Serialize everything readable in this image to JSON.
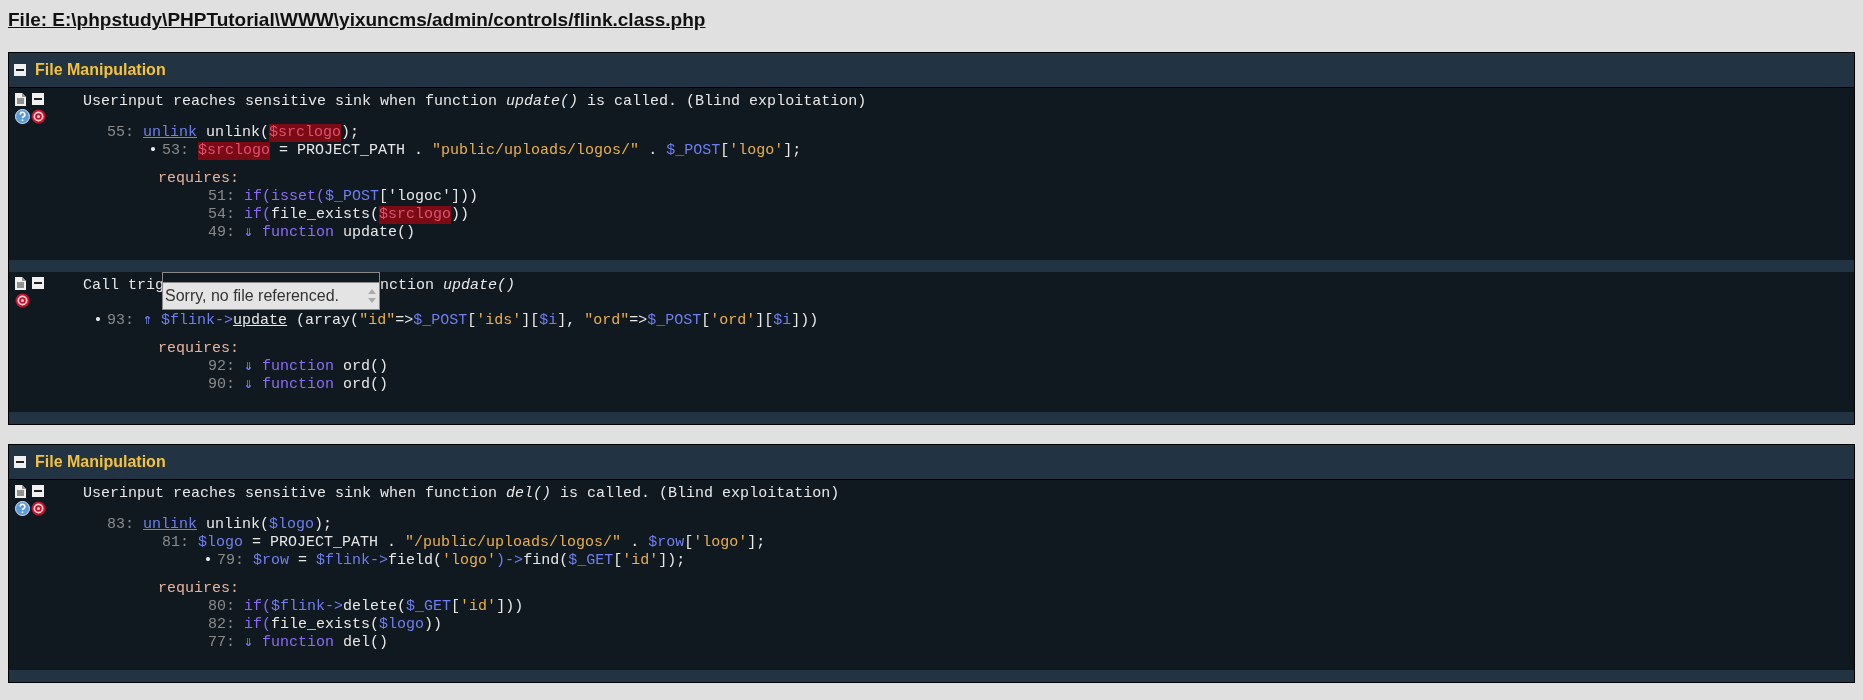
{
  "file_title": "File: E:\\phpstudy\\PHPTutorial\\WWW\\yixuncms/admin/controls/flink.class.php",
  "groups": [
    {
      "title": "File Manipulation",
      "findings": [
        {
          "help": true,
          "description": [
            "Userinput reaches sensitive sink when function *update()* is called. (Blind exploitation)"
          ],
          "trace": [
            {
              "line": "55:",
              "tokens": [
                {
                  "kind": "link",
                  "text": "unlink"
                },
                {
                  "kind": "plain",
                  "text": " unlink("
                },
                {
                  "kind": "taint",
                  "text": "$srclogo"
                },
                {
                  "kind": "plain",
                  "text": ");"
                }
              ],
              "children": [
                {
                  "line": "53:",
                  "marker": "•",
                  "tokens": [
                    {
                      "kind": "taint",
                      "text": "$srclogo"
                    },
                    {
                      "kind": "plain",
                      "text": " = PROJECT_PATH . "
                    },
                    {
                      "kind": "str",
                      "text": "\"public/uploads/logos/\""
                    },
                    {
                      "kind": "plain",
                      "text": " . "
                    },
                    {
                      "kind": "var",
                      "text": "$_POST"
                    },
                    {
                      "kind": "plain",
                      "text": "["
                    },
                    {
                      "kind": "str",
                      "text": "'logo'"
                    },
                    {
                      "kind": "plain",
                      "text": "];"
                    }
                  ]
                }
              ]
            }
          ],
          "requires": {
            "label": "requires:",
            "lines": [
              {
                "line": "51:",
                "tokens": [
                  {
                    "kind": "kw",
                    "text": "if(isset("
                  },
                  {
                    "kind": "var",
                    "text": "$_POST"
                  },
                  {
                    "kind": "plain",
                    "text": "['logoc']))"
                  }
                ]
              },
              {
                "line": "54:",
                "tokens": [
                  {
                    "kind": "kw",
                    "text": "if("
                  },
                  {
                    "kind": "plain",
                    "text": "file_exists("
                  },
                  {
                    "kind": "taint",
                    "text": "$srclogo"
                  },
                  {
                    "kind": "plain",
                    "text": "))"
                  }
                ]
              },
              {
                "line": "49:",
                "tokens": [
                  {
                    "kind": "arrow",
                    "text": "⇓ "
                  },
                  {
                    "kind": "kw",
                    "text": "function"
                  },
                  {
                    "kind": "plain",
                    "text": " update()"
                  }
                ]
              }
            ]
          }
        },
        {
          "help": false,
          "description": [
            "Call trig",
            "nction *update()*"
          ],
          "tooltip": "Sorry, no file referenced.",
          "trace": [
            {
              "line": "93:",
              "marker": "•",
              "tokens": [
                {
                  "kind": "arrow",
                  "text": "⇑ "
                },
                {
                  "kind": "var",
                  "text": "$flink->"
                },
                {
                  "kind": "uline",
                  "text": "update"
                },
                {
                  "kind": "plain",
                  "text": " (array("
                },
                {
                  "kind": "str",
                  "text": "\"id\""
                },
                {
                  "kind": "plain",
                  "text": "=>"
                },
                {
                  "kind": "var",
                  "text": "$_POST"
                },
                {
                  "kind": "plain",
                  "text": "["
                },
                {
                  "kind": "str",
                  "text": "'ids'"
                },
                {
                  "kind": "plain",
                  "text": "]["
                },
                {
                  "kind": "var",
                  "text": "$i"
                },
                {
                  "kind": "plain",
                  "text": "], "
                },
                {
                  "kind": "str",
                  "text": "\"ord\""
                },
                {
                  "kind": "plain",
                  "text": "=>"
                },
                {
                  "kind": "var",
                  "text": "$_POST"
                },
                {
                  "kind": "plain",
                  "text": "["
                },
                {
                  "kind": "str",
                  "text": "'ord'"
                },
                {
                  "kind": "plain",
                  "text": "]["
                },
                {
                  "kind": "var",
                  "text": "$i"
                },
                {
                  "kind": "plain",
                  "text": "]))"
                }
              ]
            }
          ],
          "requires": {
            "label": "requires:",
            "lines": [
              {
                "line": "92:",
                "tokens": [
                  {
                    "kind": "arrow",
                    "text": "⇓ "
                  },
                  {
                    "kind": "kw",
                    "text": "function"
                  },
                  {
                    "kind": "plain",
                    "text": " ord()"
                  }
                ]
              },
              {
                "line": "90:",
                "tokens": [
                  {
                    "kind": "arrow",
                    "text": "⇓ "
                  },
                  {
                    "kind": "kw",
                    "text": "function"
                  },
                  {
                    "kind": "plain",
                    "text": " ord()"
                  }
                ]
              }
            ]
          }
        }
      ]
    },
    {
      "title": "File Manipulation",
      "findings": [
        {
          "help": true,
          "description": [
            "Userinput reaches sensitive sink when function *del()* is called. (Blind exploitation)"
          ],
          "trace": [
            {
              "line": "83:",
              "tokens": [
                {
                  "kind": "link",
                  "text": "unlink"
                },
                {
                  "kind": "plain",
                  "text": " unlink("
                },
                {
                  "kind": "var",
                  "text": "$logo"
                },
                {
                  "kind": "plain",
                  "text": ");"
                }
              ],
              "children": [
                {
                  "line": "81:",
                  "tokens": [
                    {
                      "kind": "var",
                      "text": "$logo"
                    },
                    {
                      "kind": "plain",
                      "text": " = PROJECT_PATH . "
                    },
                    {
                      "kind": "str",
                      "text": "\"/public/uploads/logos/\""
                    },
                    {
                      "kind": "plain",
                      "text": " . "
                    },
                    {
                      "kind": "var",
                      "text": "$row"
                    },
                    {
                      "kind": "plain",
                      "text": "["
                    },
                    {
                      "kind": "str",
                      "text": "'logo'"
                    },
                    {
                      "kind": "plain",
                      "text": "];"
                    }
                  ],
                  "children": [
                    {
                      "line": "79:",
                      "marker": "•",
                      "tokens": [
                        {
                          "kind": "var",
                          "text": "$row"
                        },
                        {
                          "kind": "plain",
                          "text": " = "
                        },
                        {
                          "kind": "var",
                          "text": "$flink->"
                        },
                        {
                          "kind": "plain",
                          "text": "field("
                        },
                        {
                          "kind": "str",
                          "text": "'logo'"
                        },
                        {
                          "kind": "var",
                          "text": ")->"
                        },
                        {
                          "kind": "plain",
                          "text": "find("
                        },
                        {
                          "kind": "var",
                          "text": "$_GET"
                        },
                        {
                          "kind": "plain",
                          "text": "["
                        },
                        {
                          "kind": "str",
                          "text": "'id'"
                        },
                        {
                          "kind": "plain",
                          "text": "]);"
                        }
                      ]
                    }
                  ]
                }
              ]
            }
          ],
          "requires": {
            "label": "requires:",
            "lines": [
              {
                "line": "80:",
                "tokens": [
                  {
                    "kind": "kw",
                    "text": "if("
                  },
                  {
                    "kind": "var",
                    "text": "$flink->"
                  },
                  {
                    "kind": "plain",
                    "text": "delete("
                  },
                  {
                    "kind": "var",
                    "text": "$_GET"
                  },
                  {
                    "kind": "plain",
                    "text": "["
                  },
                  {
                    "kind": "str",
                    "text": "'id'"
                  },
                  {
                    "kind": "plain",
                    "text": "]))"
                  }
                ]
              },
              {
                "line": "82:",
                "tokens": [
                  {
                    "kind": "kw",
                    "text": "if("
                  },
                  {
                    "kind": "plain",
                    "text": "file_exists("
                  },
                  {
                    "kind": "var",
                    "text": "$logo"
                  },
                  {
                    "kind": "plain",
                    "text": "))"
                  }
                ]
              },
              {
                "line": "77:",
                "tokens": [
                  {
                    "kind": "arrow",
                    "text": "⇓ "
                  },
                  {
                    "kind": "kw",
                    "text": "function"
                  },
                  {
                    "kind": "plain",
                    "text": " del()"
                  }
                ]
              }
            ]
          }
        }
      ]
    }
  ]
}
